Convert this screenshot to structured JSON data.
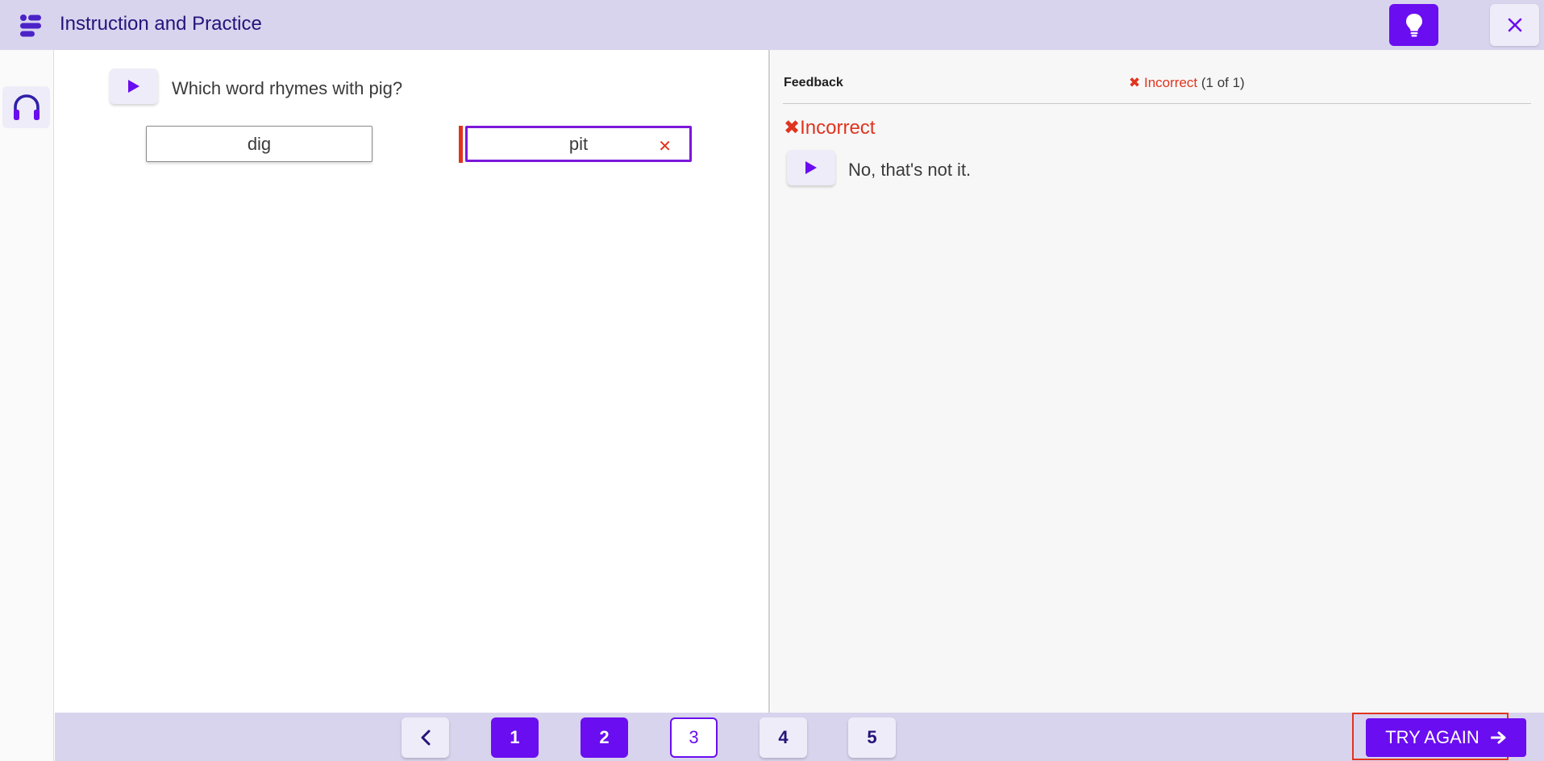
{
  "header": {
    "title": "Instruction and Practice",
    "menu_icon": "menu-icon",
    "hint_icon": "lightbulb-icon",
    "close_icon": "close-icon"
  },
  "sidebar": {
    "audio_icon": "headphones-icon"
  },
  "question": {
    "text": "Which word rhymes with pig?",
    "choices": [
      {
        "label": "dig",
        "state": "unselected"
      },
      {
        "label": "pit",
        "state": "selected-incorrect"
      }
    ]
  },
  "feedback": {
    "label": "Feedback",
    "status_word": "Incorrect",
    "attempts": "(1 of 1)",
    "heading": "Incorrect",
    "message": "No, that's not it."
  },
  "navigation": {
    "prev_icon": "chevron-left-icon",
    "pages": [
      "1",
      "2",
      "3",
      "4",
      "5"
    ],
    "current_page": "3",
    "try_again_label": "TRY AGAIN"
  },
  "colors": {
    "accent": "#6a0df0",
    "header_bg": "#d8d4ee",
    "error": "#e0341f",
    "title": "#25137a"
  }
}
